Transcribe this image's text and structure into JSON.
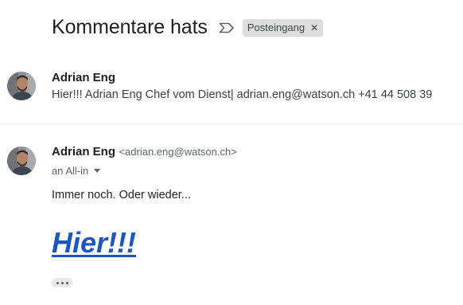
{
  "thread": {
    "subject": "Kommentare hats",
    "importance_icon": "important-marker-icon",
    "label": "Posteingang",
    "label_remove_icon": "close-icon"
  },
  "messages": [
    {
      "sender": "Adrian Eng",
      "snippet": "Hier!!! Adrian Eng Chef vom Dienst| adrian.eng@watson.ch +41 44 508 39",
      "avatar_icon": "avatar"
    },
    {
      "sender": "Adrian Eng",
      "email": "<adrian.eng@watson.ch>",
      "recipient": "an All-in",
      "recipient_caret_icon": "caret-down-icon",
      "body": "Immer noch. Oder wieder...",
      "link": "Hier!!!",
      "trimmed_content_icon": "more-horizontal-icon",
      "avatar_icon": "avatar"
    }
  ],
  "colors": {
    "link": "#1a56c9",
    "chip_bg": "#dddddd",
    "divider": "#eceff1"
  }
}
